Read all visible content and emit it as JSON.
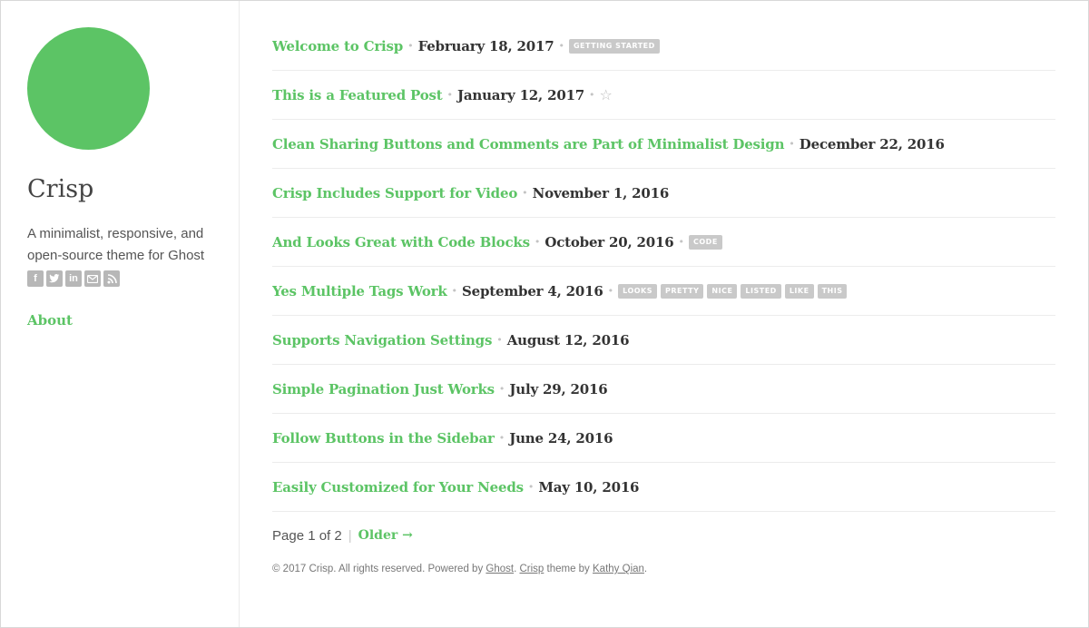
{
  "sidebar": {
    "title": "Crisp",
    "description": "A minimalist, responsive, and open-source theme for Ghost",
    "social_icons": [
      "facebook-icon",
      "twitter-icon",
      "linkedin-icon",
      "email-icon",
      "rss-icon"
    ],
    "nav": [
      {
        "label": "About"
      }
    ]
  },
  "colors": {
    "accent": "#5cc465",
    "tag_bg": "#c9c9c9",
    "text": "#333333"
  },
  "posts": [
    {
      "title": "Welcome to Crisp",
      "date": "February 18, 2017",
      "tags": [
        "GETTING STARTED"
      ],
      "featured": false
    },
    {
      "title": "This is a Featured Post",
      "date": "January 12, 2017",
      "tags": [],
      "featured": true
    },
    {
      "title": "Clean Sharing Buttons and Comments are Part of Minimalist Design",
      "date": "December 22, 2016",
      "tags": [],
      "featured": false
    },
    {
      "title": "Crisp Includes Support for Video",
      "date": "November 1, 2016",
      "tags": [],
      "featured": false
    },
    {
      "title": "And Looks Great with Code Blocks",
      "date": "October 20, 2016",
      "tags": [
        "CODE"
      ],
      "featured": false
    },
    {
      "title": "Yes Multiple Tags Work",
      "date": "September 4, 2016",
      "tags": [
        "LOOKS",
        "PRETTY",
        "NICE",
        "LISTED",
        "LIKE",
        "THIS"
      ],
      "featured": false
    },
    {
      "title": "Supports Navigation Settings",
      "date": "August 12, 2016",
      "tags": [],
      "featured": false
    },
    {
      "title": "Simple Pagination Just Works",
      "date": "July 29, 2016",
      "tags": [],
      "featured": false
    },
    {
      "title": "Follow Buttons in the Sidebar",
      "date": "June 24, 2016",
      "tags": [],
      "featured": false
    },
    {
      "title": "Easily Customized for Your Needs",
      "date": "May 10, 2016",
      "tags": [],
      "featured": false
    }
  ],
  "pagination": {
    "page_text": "Page 1 of 2",
    "divider": "|",
    "older_label": "Older →"
  },
  "footer": {
    "prefix": "© 2017 Crisp. All rights reserved. Powered by ",
    "ghost_link": "Ghost",
    "mid1": ". ",
    "crisp_link": "Crisp",
    "mid2": " theme by ",
    "author_link": "Kathy Qian",
    "suffix": "."
  }
}
